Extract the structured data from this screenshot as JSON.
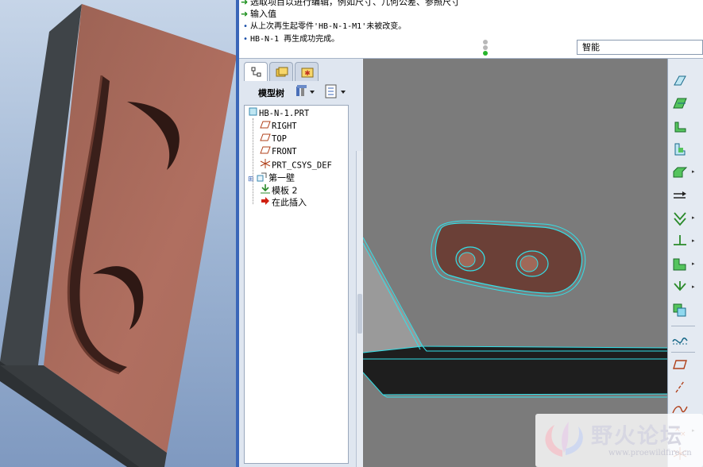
{
  "messages": [
    {
      "text": "选取项目以进行编辑，例如尺寸、几何公差、参照尺寸",
      "icon": "arrow-icon"
    },
    {
      "text": "输入值",
      "icon": "arrow-icon"
    },
    {
      "text": "从上次再生起零件'HB-N-1-M1'未被改变。",
      "icon": "bullet-icon"
    },
    {
      "text": "HB-N-1 再生成功完成。",
      "icon": "bullet-icon"
    }
  ],
  "filter": {
    "value": "智能"
  },
  "tree": {
    "title": "模型树",
    "items": [
      {
        "label": "HB-N-1.PRT",
        "icon": "part-icon"
      },
      {
        "label": "RIGHT",
        "icon": "datum-plane-icon"
      },
      {
        "label": "TOP",
        "icon": "datum-plane-icon"
      },
      {
        "label": "FRONT",
        "icon": "datum-plane-icon"
      },
      {
        "label": "PRT_CSYS_DEF",
        "icon": "csys-icon"
      },
      {
        "label": "第一壁",
        "icon": "wall-icon"
      },
      {
        "label": "模板 2",
        "icon": "punch-icon"
      },
      {
        "label": "在此插入",
        "icon": "insert-here-icon"
      }
    ]
  },
  "watermark": {
    "title": "野火论坛",
    "url": "www.proewildfire.cn"
  },
  "colors": {
    "part": "#a06858",
    "edge_highlight": "#33e0e8",
    "background": "#7c7c7c"
  }
}
